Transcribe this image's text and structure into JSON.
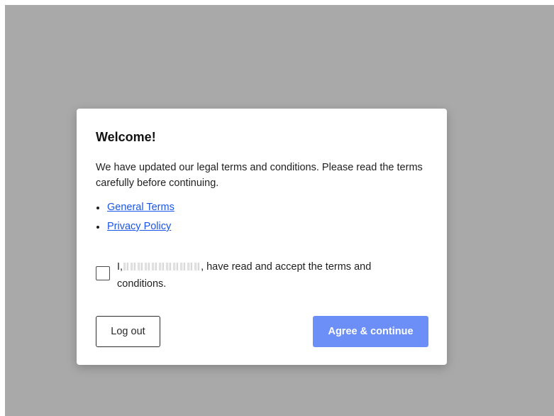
{
  "dialog": {
    "title": "Welcome!",
    "intro": "We have updated our legal terms and conditions. Please read the terms carefully before continuing.",
    "links": [
      {
        "label": "General Terms"
      },
      {
        "label": "Privacy Policy"
      }
    ],
    "consent": {
      "prefix": "I,",
      "suffix": ", have read and accept the terms and conditions.",
      "checked": false
    },
    "buttons": {
      "logout_label": "Log out",
      "agree_label": "Agree & continue"
    }
  },
  "colors": {
    "overlay": "#a9a9a9",
    "link": "#1a55e8",
    "primary_button": "#6b8ff6"
  }
}
